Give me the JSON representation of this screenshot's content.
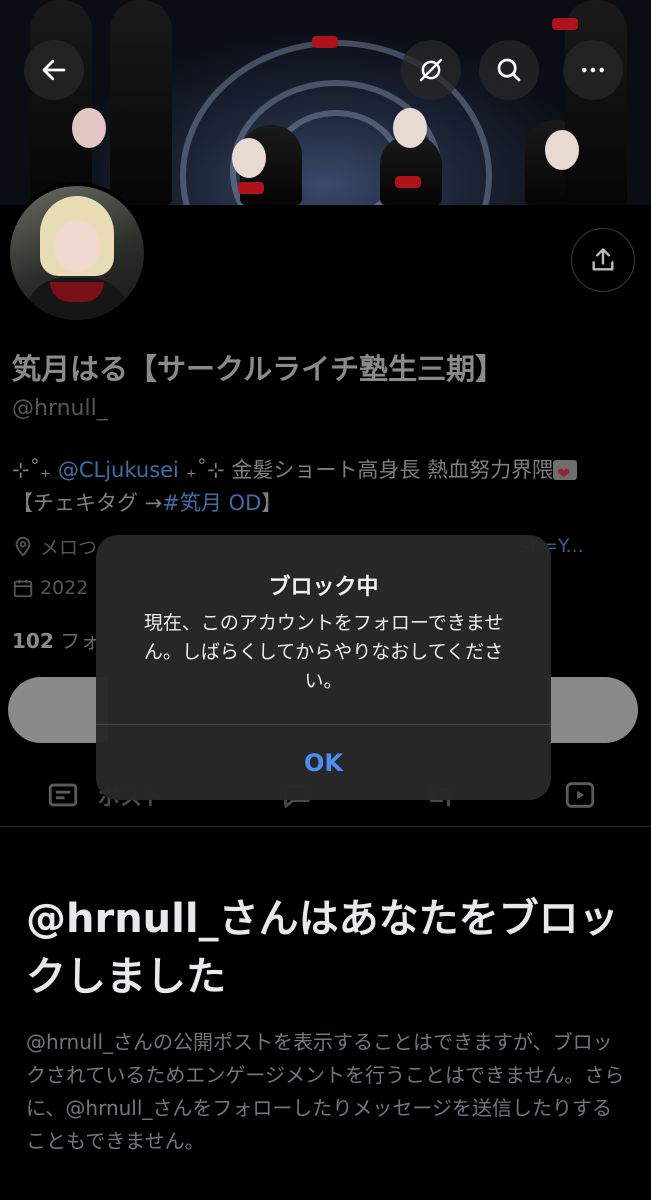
{
  "profile": {
    "display_name": "笂月はる【サークルライチ塾生三期】",
    "handle": "@hrnull_",
    "bio_prefix": "⊹˚₊ ",
    "bio_mention": "@CLjukusei",
    "bio_middle": " ₊˚⊹ 金髪ショート高身長 熱血努力界隈",
    "bio_line2_prefix": "【チェキタグ →",
    "bio_hashtag": "#笂月 OD",
    "bio_line2_suffix": "】",
    "location_text": "メロつ",
    "link_text": "sh=Y...",
    "joined_text": "2022",
    "following_count": "102",
    "following_label": " フォ"
  },
  "tabs": {
    "posts_label": "ポスト"
  },
  "blocked": {
    "title": "@hrnull_さんはあなたをブロックしました",
    "description": "@hrnull_さんの公開ポストを表示することはできますが、ブロックされているためエンゲージメントを行うことはできません。さらに、@hrnull_さんをフォローしたりメッセージを送信したりすることもできません。"
  },
  "alert": {
    "title": "ブロック中",
    "message": "現在、このアカウントをフォローできません。しばらくしてからやりなおしてください。",
    "ok_label": "OK"
  },
  "icons": {
    "back": "arrow-left-icon",
    "grok": "grok-icon",
    "search": "search-icon",
    "more": "more-icon",
    "share": "share-icon",
    "location": "location-pin-icon",
    "calendar": "calendar-icon",
    "posts_tab": "posts-tab-icon",
    "replies_tab": "replies-tab-icon",
    "retweet_tab": "retweet-tab-icon",
    "media_tab": "media-tab-icon"
  },
  "colors": {
    "background": "#000000",
    "alert_bg": "#282828",
    "ok_button": "#4a8ff0",
    "link": "#3b6ea5",
    "muted_text": "#71767b"
  }
}
